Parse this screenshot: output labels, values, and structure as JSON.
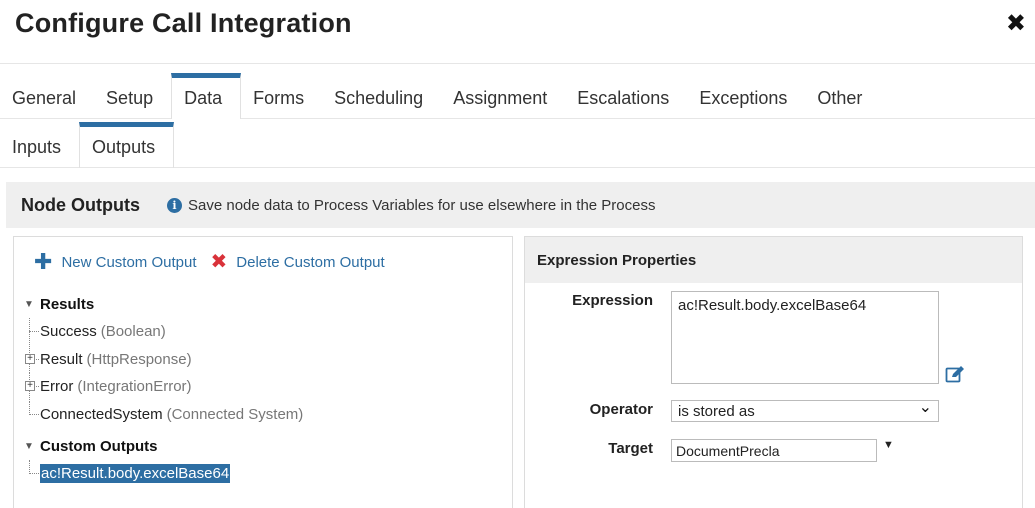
{
  "dialog": {
    "title": "Configure Call Integration",
    "close_glyph": "✖"
  },
  "main_tabs": [
    {
      "label": "General"
    },
    {
      "label": "Setup"
    },
    {
      "label": "Data"
    },
    {
      "label": "Forms"
    },
    {
      "label": "Scheduling"
    },
    {
      "label": "Assignment"
    },
    {
      "label": "Escalations"
    },
    {
      "label": "Exceptions"
    },
    {
      "label": "Other"
    }
  ],
  "active_main_tab": "Data",
  "sub_tabs": [
    {
      "label": "Inputs"
    },
    {
      "label": "Outputs"
    }
  ],
  "active_sub_tab": "Outputs",
  "section": {
    "title": "Node Outputs",
    "description": "Save node data to Process Variables for use elsewhere in the Process"
  },
  "toolbar": {
    "new_label": "New Custom Output",
    "delete_label": "Delete Custom Output"
  },
  "tree": {
    "results_label": "Results",
    "results": [
      {
        "name": "Success",
        "type": "(Boolean)"
      },
      {
        "name": "Result",
        "type": "(HttpResponse)"
      },
      {
        "name": "Error",
        "type": "(IntegrationError)"
      },
      {
        "name": "ConnectedSystem",
        "type": "(Connected System)"
      }
    ],
    "custom_label": "Custom Outputs",
    "custom": [
      {
        "name": "ac!Result.body.excelBase64"
      }
    ]
  },
  "properties": {
    "header": "Expression Properties",
    "expression_label": "Expression",
    "expression_value": "ac!Result.body.excelBase64",
    "operator_label": "Operator",
    "operator_value": "is stored as",
    "target_label": "Target",
    "target_value": "DocumentPrecla"
  },
  "colors": {
    "accent": "#2d6ea3",
    "delete": "#d9323a",
    "panel_bg": "#efefef"
  }
}
